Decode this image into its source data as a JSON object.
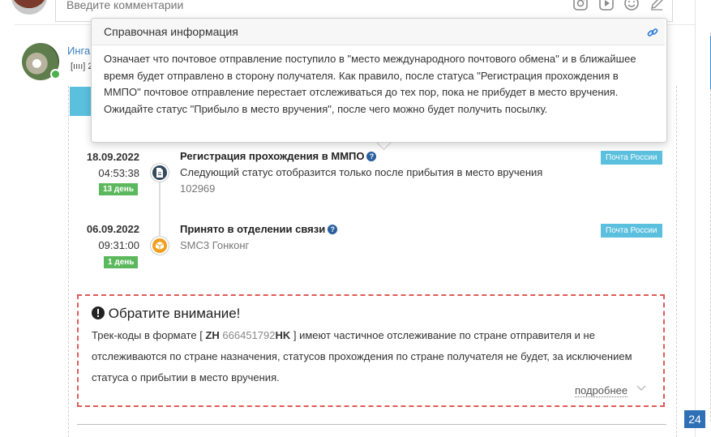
{
  "comment_form": {
    "placeholder": "Введите комментарии",
    "icons": [
      "instagram-icon",
      "video-icon",
      "smile-icon",
      "pen-icon"
    ]
  },
  "comment": {
    "author": "Инга",
    "barcode_prefix": "[ıııı] 2"
  },
  "tooltip": {
    "title": "Справочная информация",
    "link_icon": "link-icon",
    "text": "Означает что почтовое отправление поступило в \"место международного почтового обмена\" и в ближайшее время будет отправлено в сторону получателя. Как правило, после статуса \"Регистрация прохождения в ММПО\" почтовое отправление перестает отслеживаться до тех пор, пока не прибудет в место вручения. Ожидайте статус \"Прибыло в место вручения\", после чего можно будет получить посылку."
  },
  "events": [
    {
      "date": "18.09.2022",
      "time": "04:53:38",
      "day": "13 день",
      "title": "Регистрация прохождения в ММПО",
      "description": "Следующий статус отобразится только после прибытия в место вручения",
      "sub": "102969",
      "carrier": "Почта России",
      "icon": "document-icon",
      "color": "#34495e"
    },
    {
      "date": "06.09.2022",
      "time": "09:31:00",
      "day": "1 день",
      "title": "Принято в отделении связи",
      "description": "",
      "sub": "SMC3 Гонконг",
      "carrier": "Почта России",
      "icon": "package-icon",
      "color": "#f0a020"
    }
  ],
  "notice": {
    "title": "Обратите внимание!",
    "text_before": "Трек-коды в формате [ ",
    "code_prefix": "ZH",
    "code_digits": "666451792",
    "code_suffix": "HK",
    "text_after": " ] имеют частичное отслеживание по стране отправителя и не отслеживаются по стране назначения, статусов прохождения по стране получателя не будет, за исключением статуса о прибытии в место вручения.",
    "more_label": "подробнее"
  },
  "page_number": "24",
  "colors": {
    "accent": "#5bc0de",
    "day_badge": "#5cb85c",
    "notice_border": "#e05a5a",
    "link": "#2b7bd6"
  }
}
